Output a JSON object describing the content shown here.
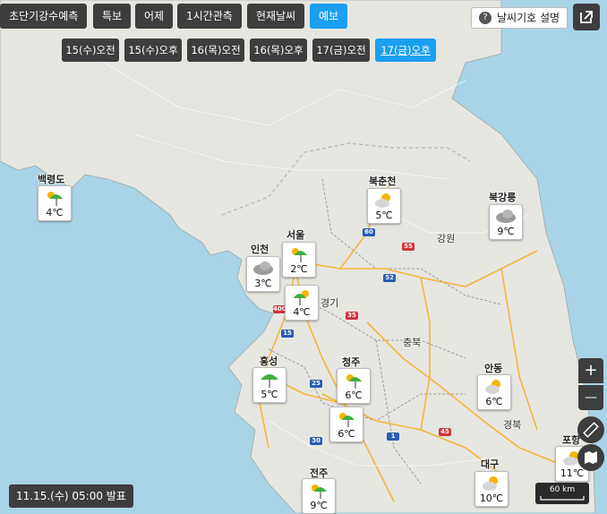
{
  "top_buttons": [
    {
      "label": "초단기강수예측",
      "active": false
    },
    {
      "label": "특보",
      "active": false
    },
    {
      "label": "어제",
      "active": false
    },
    {
      "label": "1시간관측",
      "active": false
    },
    {
      "label": "현재날씨",
      "active": false
    },
    {
      "label": "예보",
      "active": true
    }
  ],
  "time_buttons": [
    {
      "label": "15(수)오전",
      "active": false
    },
    {
      "label": "15(수)오후",
      "active": false
    },
    {
      "label": "16(목)오전",
      "active": false
    },
    {
      "label": "16(목)오후",
      "active": false
    },
    {
      "label": "17(금)오전",
      "active": false
    },
    {
      "label": "17(금)오후",
      "active": true
    }
  ],
  "help_label": "날씨기호 설명",
  "issue_time": "11.15.(수) 05:00 발표",
  "scale_label": "60 km",
  "zoom_in": "+",
  "zoom_out": "—",
  "regions": [
    "강원",
    "경기",
    "충북",
    "경북"
  ],
  "stations": [
    {
      "name": "백령도",
      "temp": "4℃",
      "icon": "umbrella-sun-icon"
    },
    {
      "name": "북춘천",
      "temp": "5℃",
      "icon": "sun-cloud-icon"
    },
    {
      "name": "북강릉",
      "temp": "9℃",
      "icon": "cloud-icon"
    },
    {
      "name": "인천",
      "temp": "3℃",
      "icon": "cloud-icon"
    },
    {
      "name": "서울",
      "temp": "2℃",
      "icon": "umbrella-sun-icon"
    },
    {
      "name": "",
      "temp": "4℃",
      "icon": "umbrella-sun-icon"
    },
    {
      "name": "홍성",
      "temp": "5℃",
      "icon": "umbrella-icon"
    },
    {
      "name": "청주",
      "temp": "6℃",
      "icon": "umbrella-sun-icon"
    },
    {
      "name": "",
      "temp": "6℃",
      "icon": "umbrella-sun-icon"
    },
    {
      "name": "안동",
      "temp": "6℃",
      "icon": "sun-cloud-icon"
    },
    {
      "name": "전주",
      "temp": "9℃",
      "icon": "umbrella-sun-icon"
    },
    {
      "name": "대구",
      "temp": "10℃",
      "icon": "sun-cloud-icon"
    },
    {
      "name": "포항",
      "temp": "11℃",
      "icon": "sun-cloud-icon"
    }
  ],
  "highways": [
    "60",
    "55",
    "52",
    "400",
    "35",
    "15",
    "25",
    "45",
    "1",
    "30"
  ],
  "colors": {
    "sea": "#a9d3e6",
    "land": "#e8e8e3",
    "button": "#3d3d3d",
    "active": "#1a9ff0",
    "road": "#f2b63c"
  }
}
